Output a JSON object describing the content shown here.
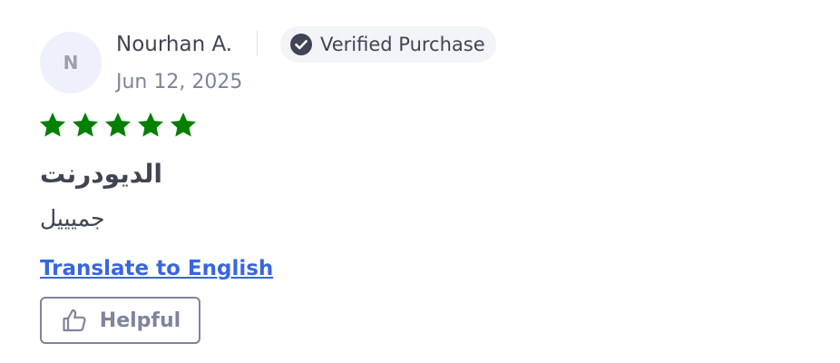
{
  "reviewer": {
    "initial": "N",
    "name": "Nourhan A.",
    "date": "Jun 12, 2025"
  },
  "badge": {
    "label": "Verified Purchase",
    "icon": "check-circle-icon"
  },
  "rating": {
    "stars": 5,
    "max": 5,
    "color": "#038000"
  },
  "review": {
    "title": "الديودرنت",
    "body": "جميييل"
  },
  "actions": {
    "translate_label": "Translate to English",
    "helpful_label": "Helpful",
    "helpful_icon": "thumbs-up-icon"
  },
  "colors": {
    "text": "#404553",
    "muted": "#7e859b",
    "link": "#3866df",
    "star": "#038000"
  }
}
